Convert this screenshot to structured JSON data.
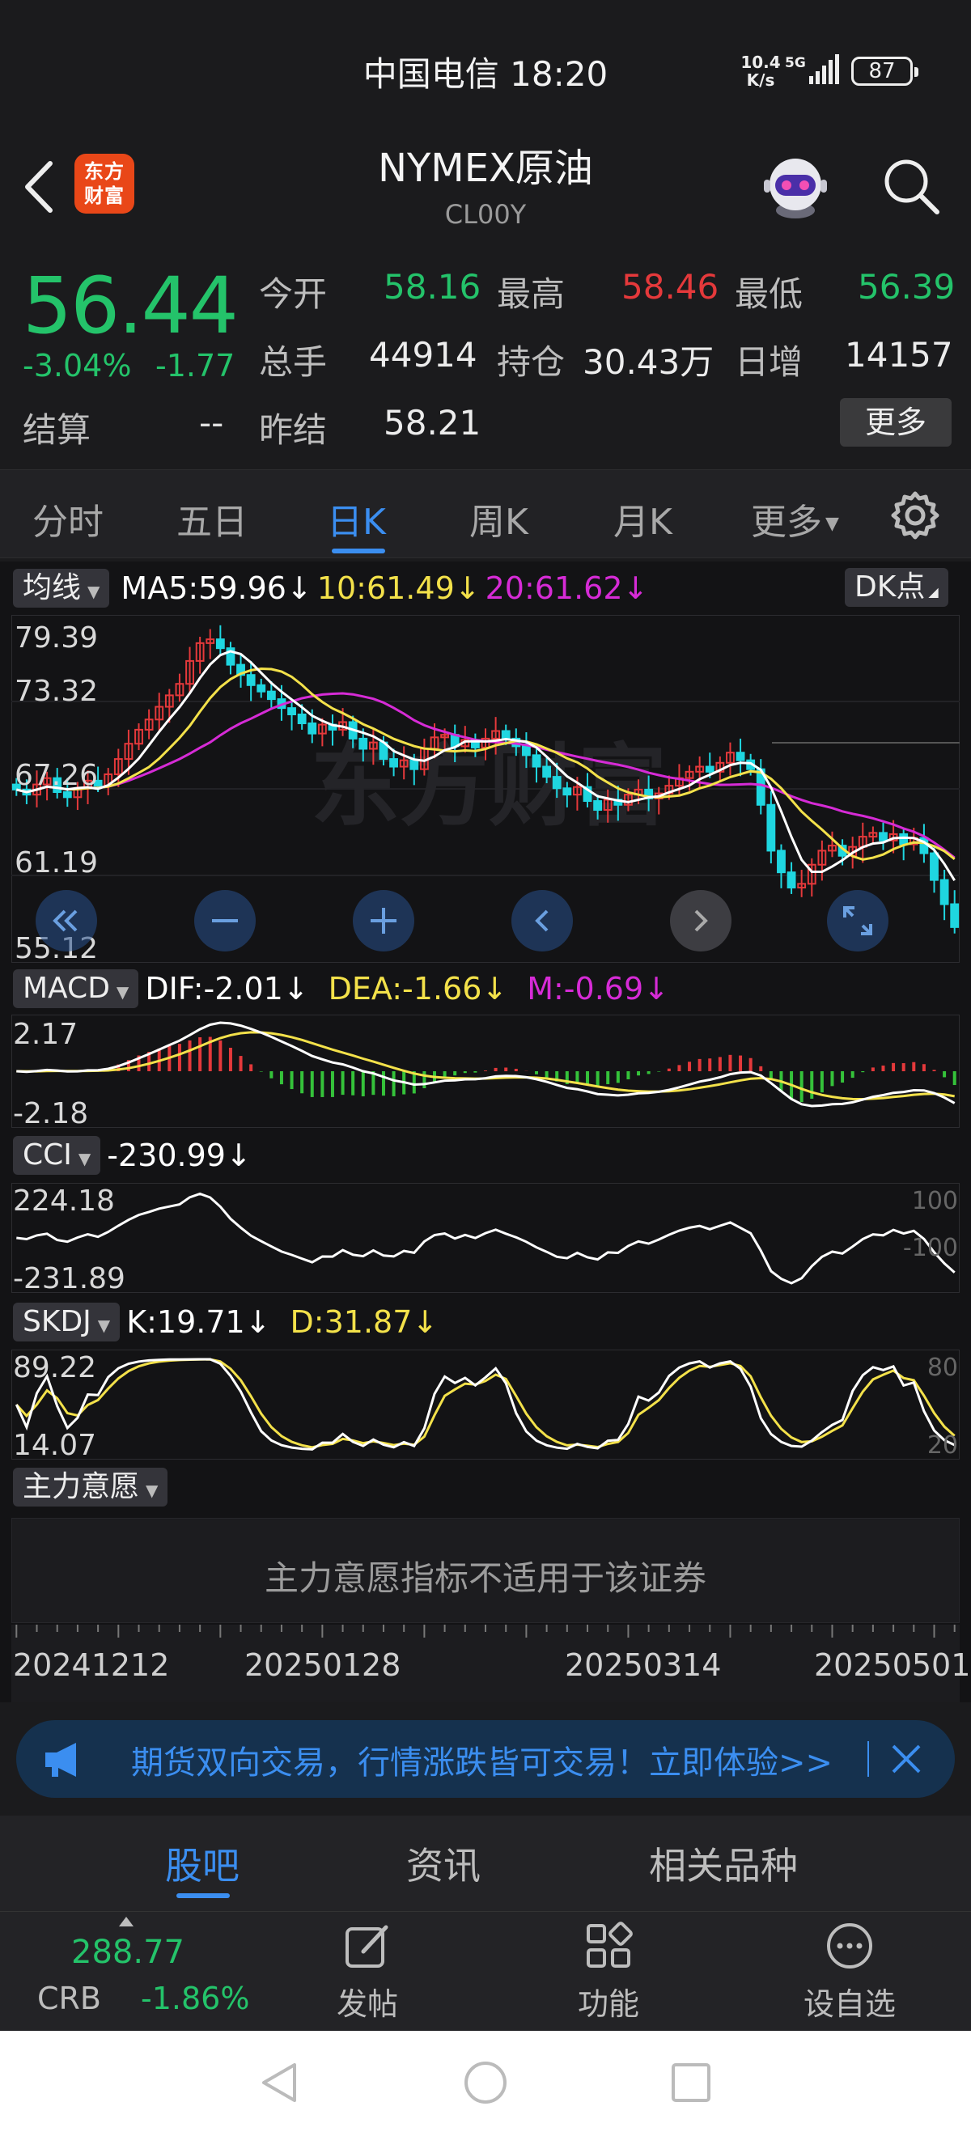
{
  "status_bar": {
    "carrier_time": "中国电信 18:20",
    "net_speed_value": "10.4",
    "net_speed_unit": "K/s",
    "network": "5G",
    "battery": "87"
  },
  "header": {
    "logo_text_line1": "东方",
    "logo_text_line2": "财富",
    "title": "NYMEX原油",
    "subtitle": "CL00Y"
  },
  "quote": {
    "price": "56.44",
    "change_pct": "-3.04%",
    "change_abs": "-1.77",
    "settle_label": "结算",
    "settle_value": "--",
    "fields": [
      {
        "label": "今开",
        "value": "58.16",
        "color": "green"
      },
      {
        "label": "最高",
        "value": "58.46",
        "color": "red"
      },
      {
        "label": "最低",
        "value": "56.39",
        "color": "green"
      },
      {
        "label": "总手",
        "value": "44914",
        "color": "white"
      },
      {
        "label": "持仓",
        "value": "30.43万",
        "color": "white"
      },
      {
        "label": "日增",
        "value": "14157",
        "color": "white"
      },
      {
        "label": "昨结",
        "value": "58.21",
        "color": "white"
      }
    ],
    "more_label": "更多"
  },
  "period_tabs": [
    "分时",
    "五日",
    "日K",
    "周K",
    "月K",
    "更多"
  ],
  "active_period": 2,
  "chart": {
    "ma_selector": "均线",
    "ma5": "MA5:59.96↓",
    "ma10": "10:61.49↓",
    "ma20": "20:61.62↓",
    "dk_label": "DK点",
    "price_ticks": [
      "79.39",
      "73.32",
      "67.26",
      "61.19",
      "55.12"
    ],
    "macd_selector": "MACD",
    "dif": "DIF:-2.01↓",
    "dea": "DEA:-1.66↓",
    "m": "M:-0.69↓",
    "macd_ticks": [
      "2.17",
      "-2.18"
    ],
    "cci_selector": "CCI",
    "cci_value": "-230.99↓",
    "cci_ticks": [
      "224.18",
      "-231.89"
    ],
    "cci_right_ticks": [
      "100",
      "-100"
    ],
    "skdj_selector": "SKDJ",
    "k_value": "K:19.71↓",
    "d_value": "D:31.87↓",
    "skdj_ticks": [
      "89.22",
      "14.07"
    ],
    "skdj_right_ticks": [
      "80",
      "20"
    ],
    "zlyy_selector": "主力意愿",
    "zlyy_message": "主力意愿指标不适用于该证券",
    "dates": [
      "20241212",
      "20250128",
      "20250314",
      "20250501"
    ],
    "watermark": "东方财富",
    "colors": {
      "up": "#e5393b",
      "down": "#1fd6e0",
      "ma5": "#ffffff",
      "ma10": "#f3e14a",
      "ma20": "#d62bd6",
      "macd_up": "#e5393b",
      "macd_down": "#35c23a"
    }
  },
  "chart_data": {
    "type": "candlestick",
    "ylim": [
      55.12,
      79.39
    ],
    "closes": [
      67.2,
      66.8,
      67.6,
      68.1,
      67.0,
      66.6,
      67.3,
      67.9,
      67.5,
      68.4,
      69.6,
      70.8,
      71.9,
      72.7,
      73.7,
      74.6,
      75.5,
      77.3,
      78.7,
      79.0,
      78.3,
      77.0,
      76.2,
      75.4,
      74.9,
      74.3,
      73.6,
      73.1,
      72.4,
      71.6,
      72.3,
      71.9,
      72.5,
      71.2,
      70.4,
      70.9,
      69.6,
      69.0,
      69.5,
      68.8,
      70.4,
      71.3,
      71.5,
      70.6,
      71.1,
      70.5,
      71.2,
      71.8,
      71.2,
      70.6,
      69.9,
      69.0,
      68.2,
      67.3,
      66.8,
      67.4,
      66.3,
      65.6,
      66.4,
      66.0,
      66.8,
      67.2,
      66.5,
      66.9,
      67.5,
      68.1,
      68.6,
      69.0,
      68.6,
      69.3,
      70.1,
      69.5,
      68.8,
      66.0,
      62.4,
      60.7,
      59.5,
      59.8,
      61.3,
      62.4,
      62.8,
      62.0,
      62.7,
      63.5,
      63.8,
      63.2,
      63.7,
      62.9,
      63.4,
      62.2,
      60.1,
      58.2,
      56.4
    ]
  },
  "promo": {
    "text": "期货双向交易，行情涨跌皆可交易！立即体验>>"
  },
  "section_tabs": [
    "股吧",
    "资讯",
    "相关品种"
  ],
  "active_section": 0,
  "bottom": {
    "crb_value": "288.77",
    "crb_label": "CRB",
    "crb_change": "-1.86%",
    "tools": [
      "发帖",
      "功能",
      "设自选"
    ]
  }
}
